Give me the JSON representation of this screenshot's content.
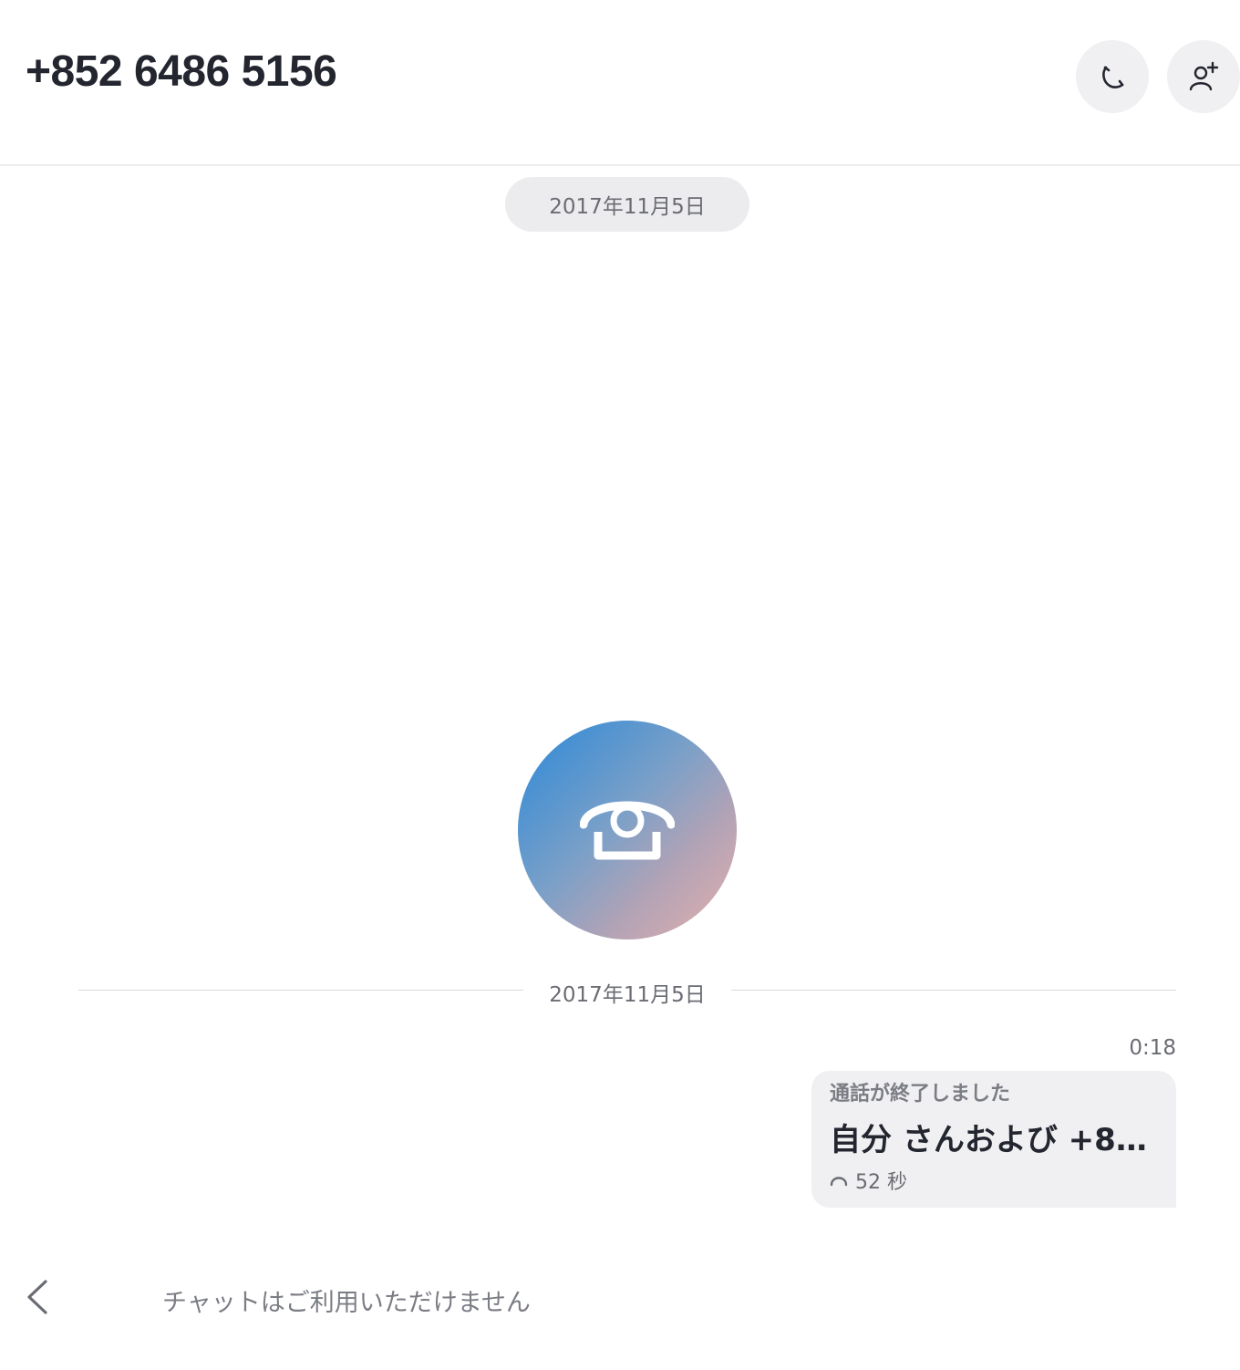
{
  "header": {
    "title": "+852 6486 5156",
    "call_button_icon": "phone-icon",
    "add_person_button_icon": "add-person-icon"
  },
  "conversation": {
    "date_pill": "2017年11月5日",
    "avatar_icon": "telephone-icon",
    "divider_date": "2017年11月5日",
    "message": {
      "time": "0:18",
      "label": "通話が終了しました",
      "main_text": "自分 さんおよび +8...",
      "duration_icon": "call-icon",
      "duration": "52 秒"
    }
  },
  "footer": {
    "back_icon": "chevron-left-icon",
    "status_text": "チャットはご利用いただけません"
  },
  "colors": {
    "avatar_gradient_start": "#2a88d8",
    "avatar_gradient_end": "#e5b0ad",
    "bubble_bg": "#f0f0f2"
  }
}
